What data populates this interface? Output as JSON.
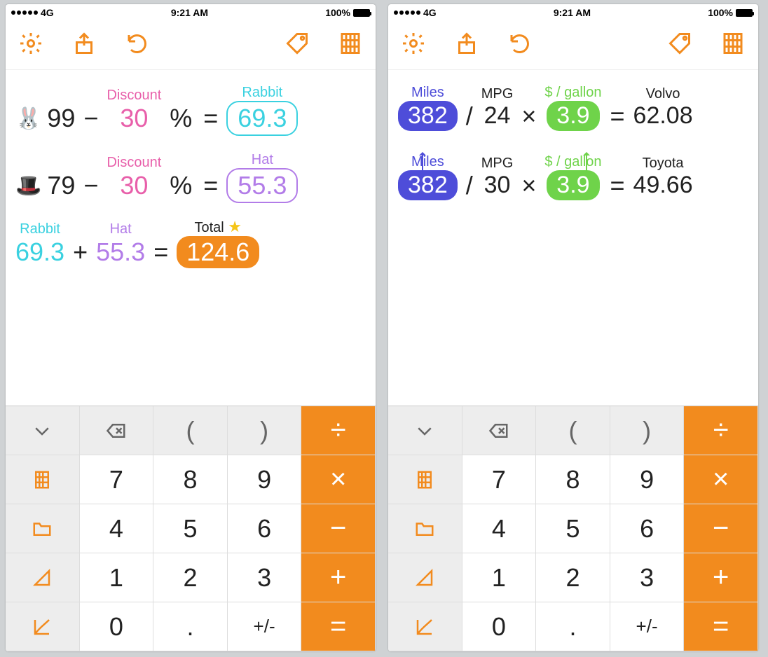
{
  "status": {
    "carrier": "4G",
    "time": "9:21 AM",
    "battery": "100%"
  },
  "colors": {
    "accent": "#f28b1e",
    "blue": "#4e4dd9",
    "green": "#6fd34a",
    "cyan": "#3ad1e0",
    "purple": "#b27ce8",
    "pink": "#e85faa"
  },
  "left": {
    "rows": [
      {
        "icon": "🐰",
        "a": "99",
        "op1": "−",
        "discount_label": "Discount",
        "b": "30",
        "pct": "%",
        "eq": "=",
        "result_label": "Rabbit",
        "result": "69.3",
        "result_style": "cyan"
      },
      {
        "icon": "🎩",
        "a": "79",
        "op1": "−",
        "discount_label": "Discount",
        "b": "30",
        "pct": "%",
        "eq": "=",
        "result_label": "Hat",
        "result": "55.3",
        "result_style": "purple"
      }
    ],
    "sum": {
      "a_label": "Rabbit",
      "a": "69.3",
      "op": "+",
      "b_label": "Hat",
      "b": "55.3",
      "eq": "=",
      "total_label": "Total",
      "total": "124.6"
    }
  },
  "right": {
    "rows": [
      {
        "miles_label": "Miles",
        "miles": "382",
        "op1": "/",
        "mpg_label": "MPG",
        "mpg": "24",
        "op2": "×",
        "price_label": "$ / gallon",
        "price": "3.9",
        "eq": "=",
        "brand": "Volvo",
        "result": "62.08"
      },
      {
        "miles_label": "Miles",
        "miles": "382",
        "op1": "/",
        "mpg_label": "MPG",
        "mpg": "30",
        "op2": "×",
        "price_label": "$ / gallon",
        "price": "3.9",
        "eq": "=",
        "brand": "Toyota",
        "result": "49.66"
      }
    ]
  },
  "keypad": {
    "r1": {
      "collapse": "⌄",
      "backspace": "⌫",
      "lp": "(",
      "rp": ")",
      "div": "÷"
    },
    "r2": {
      "side": "grid",
      "k7": "7",
      "k8": "8",
      "k9": "9",
      "mul": "×"
    },
    "r3": {
      "side": "folder",
      "k4": "4",
      "k5": "5",
      "k6": "6",
      "sub": "−"
    },
    "r4": {
      "side": "angle",
      "k1": "1",
      "k2": "2",
      "k3": "3",
      "add": "+"
    },
    "r5": {
      "side": "graph",
      "k0": "0",
      "dot": ".",
      "pm": "+/-",
      "eq": "="
    }
  }
}
